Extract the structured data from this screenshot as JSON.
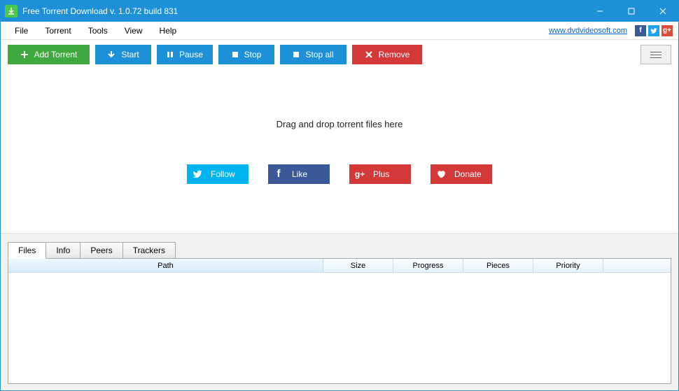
{
  "title": "Free Torrent Download v. 1.0.72 build 831",
  "menu": {
    "file": "File",
    "torrent": "Torrent",
    "tools": "Tools",
    "view": "View",
    "help": "Help"
  },
  "site_link": "www.dvdvideosoft.com",
  "toolbar": {
    "add": "Add Torrent",
    "start": "Start",
    "pause": "Pause",
    "stop": "Stop",
    "stopall": "Stop all",
    "remove": "Remove"
  },
  "drop_hint": "Drag and drop torrent files here",
  "social": {
    "follow": "Follow",
    "like": "Like",
    "plus": "Plus",
    "donate": "Donate"
  },
  "tabs": {
    "files": "Files",
    "info": "Info",
    "peers": "Peers",
    "trackers": "Trackers"
  },
  "columns": {
    "path": "Path",
    "size": "Size",
    "progress": "Progress",
    "pieces": "Pieces",
    "priority": "Priority"
  }
}
